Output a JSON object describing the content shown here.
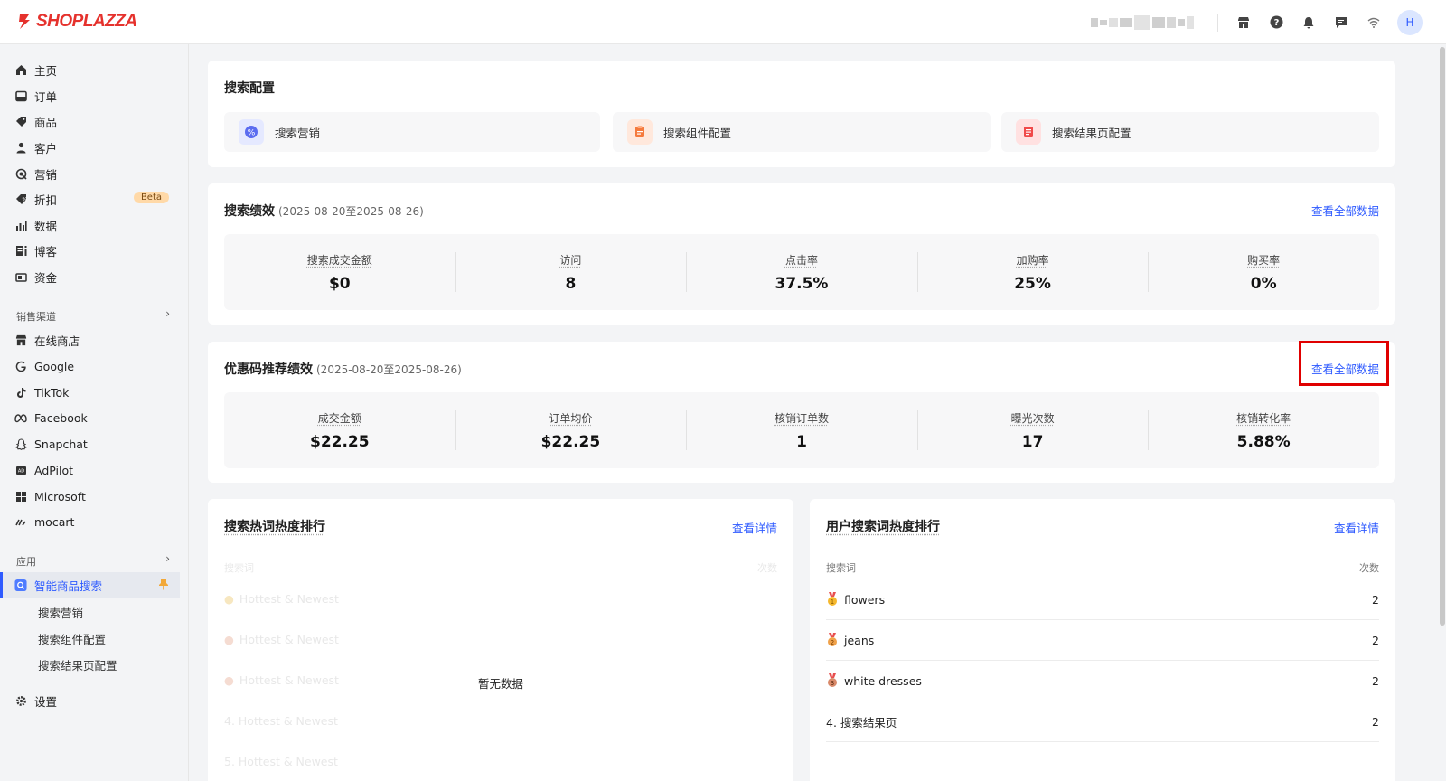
{
  "topbar": {
    "brand": "SHOPLAZZA",
    "avatar_initial": "H",
    "icons": [
      "store-icon",
      "help-icon",
      "bell-icon",
      "message-icon",
      "wifi-icon"
    ]
  },
  "sidebar": {
    "items": [
      {
        "label": "主页",
        "icon": "home-icon"
      },
      {
        "label": "订单",
        "icon": "order-icon"
      },
      {
        "label": "商品",
        "icon": "tag-icon"
      },
      {
        "label": "客户",
        "icon": "user-icon"
      },
      {
        "label": "营销",
        "icon": "marketing-icon"
      },
      {
        "label": "折扣",
        "icon": "discount-icon",
        "badge": "Beta"
      },
      {
        "label": "数据",
        "icon": "chart-icon"
      },
      {
        "label": "博客",
        "icon": "blog-icon"
      },
      {
        "label": "资金",
        "icon": "wallet-icon"
      }
    ],
    "sales_channel_header": "销售渠道",
    "channels": [
      {
        "label": "在线商店",
        "icon": "store-icon"
      },
      {
        "label": "Google",
        "icon": "google-icon"
      },
      {
        "label": "TikTok",
        "icon": "tiktok-icon"
      },
      {
        "label": "Facebook",
        "icon": "meta-icon"
      },
      {
        "label": "Snapchat",
        "icon": "snapchat-icon"
      },
      {
        "label": "AdPilot",
        "icon": "adpilot-icon"
      },
      {
        "label": "Microsoft",
        "icon": "microsoft-icon"
      },
      {
        "label": "mocart",
        "icon": "mocart-icon"
      }
    ],
    "apps_header": "应用",
    "active_app": "智能商品搜索",
    "sub_items": [
      "搜索营销",
      "搜索组件配置",
      "搜索结果页配置"
    ],
    "settings": "设置"
  },
  "search_config": {
    "title": "搜索配置",
    "items": [
      {
        "label": "搜索营销",
        "color": "#5b6cf0"
      },
      {
        "label": "搜索组件配置",
        "color": "#f57a3d"
      },
      {
        "label": "搜索结果页配置",
        "color": "#f04a4a"
      }
    ]
  },
  "search_perf": {
    "title": "搜索绩效",
    "range": "(2025-08-20至2025-08-26)",
    "link": "查看全部数据",
    "stats": [
      {
        "label": "搜索成交金额",
        "value": "$0"
      },
      {
        "label": "访问",
        "value": "8"
      },
      {
        "label": "点击率",
        "value": "37.5%"
      },
      {
        "label": "加购率",
        "value": "25%"
      },
      {
        "label": "购买率",
        "value": "0%"
      }
    ]
  },
  "coupon_perf": {
    "title": "优惠码推荐绩效",
    "range": "(2025-08-20至2025-08-26)",
    "link": "查看全部数据",
    "stats": [
      {
        "label": "成交金额",
        "value": "$22.25"
      },
      {
        "label": "订单均价",
        "value": "$22.25"
      },
      {
        "label": "核销订单数",
        "value": "1"
      },
      {
        "label": "曝光次数",
        "value": "17"
      },
      {
        "label": "核销转化率",
        "value": "5.88%"
      }
    ]
  },
  "hot_words": {
    "title": "搜索热词热度排行",
    "link": "查看详情",
    "col_word": "搜索词",
    "col_count": "次数",
    "placeholder_rows": [
      "Hottest & Newest",
      "Hottest & Newest",
      "Hottest & Newest",
      "4. Hottest & Newest",
      "5. Hottest & Newest"
    ],
    "empty": "暂无数据"
  },
  "user_words": {
    "title": "用户搜索词热度排行",
    "link": "查看详情",
    "col_word": "搜索词",
    "col_count": "次数",
    "rows": [
      {
        "word": "flowers",
        "count": "2",
        "medal": "gold"
      },
      {
        "word": "jeans",
        "count": "2",
        "medal": "silver"
      },
      {
        "word": "white dresses",
        "count": "2",
        "medal": "bronze"
      },
      {
        "word": "4. 搜索结果页",
        "count": "2"
      }
    ]
  }
}
